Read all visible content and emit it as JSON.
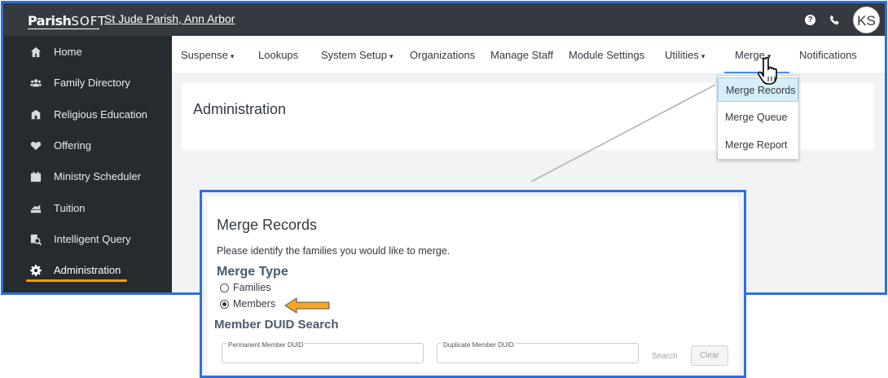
{
  "app": {
    "logo_bold": "Parish",
    "logo_light": "SOFT",
    "parish_name": "St Jude Parish, Ann Arbor",
    "user_initials": "KS"
  },
  "topbar": {
    "help_icon": "question-circle-icon",
    "phone_icon": "phone-icon"
  },
  "sidebar": {
    "items": [
      {
        "label": "Home",
        "icon": "home-icon"
      },
      {
        "label": "Family Directory",
        "icon": "users-icon"
      },
      {
        "label": "Religious Education",
        "icon": "school-icon"
      },
      {
        "label": "Offering",
        "icon": "heart-icon"
      },
      {
        "label": "Ministry Scheduler",
        "icon": "calendar-icon"
      },
      {
        "label": "Tuition",
        "icon": "tuition-icon"
      },
      {
        "label": "Intelligent Query",
        "icon": "query-icon"
      },
      {
        "label": "Administration",
        "icon": "gear-icon",
        "active": true
      }
    ]
  },
  "nav": {
    "items": [
      {
        "label": "Suspense",
        "caret": "▾"
      },
      {
        "label": "Lookups",
        "caret": ""
      },
      {
        "label": "System Setup",
        "caret": "▾"
      },
      {
        "label": "Organizations",
        "caret": ""
      },
      {
        "label": "Manage Staff",
        "caret": ""
      },
      {
        "label": "Module Settings",
        "caret": ""
      },
      {
        "label": "Utilities",
        "caret": "▾"
      },
      {
        "label": "Merge",
        "caret": "▾",
        "active": true
      },
      {
        "label": "Notifications",
        "caret": ""
      }
    ]
  },
  "admin": {
    "title": "Administration"
  },
  "merge_menu": {
    "items": [
      "Merge Records",
      "Merge Queue",
      "Merge Report"
    ],
    "highlighted": "Merge Records"
  },
  "merge_records": {
    "title": "Merge Records",
    "subtitle": "Please identify the families you would like to merge.",
    "type_heading": "Merge Type",
    "options": [
      {
        "label": "Families",
        "selected": false
      },
      {
        "label": "Members",
        "selected": true
      }
    ],
    "duid_heading": "Member DUID Search",
    "permanent_label": "Permanent Member DUID",
    "duplicate_label": "Duplicate Member DUID",
    "search_label": "Search",
    "clear_label": "Clear"
  },
  "colors": {
    "frame": "#2f6fdc",
    "topbar": "#343a40",
    "sidebar": "#262b30",
    "active_underline": "#f0a000",
    "arrow": "#f5a623"
  }
}
